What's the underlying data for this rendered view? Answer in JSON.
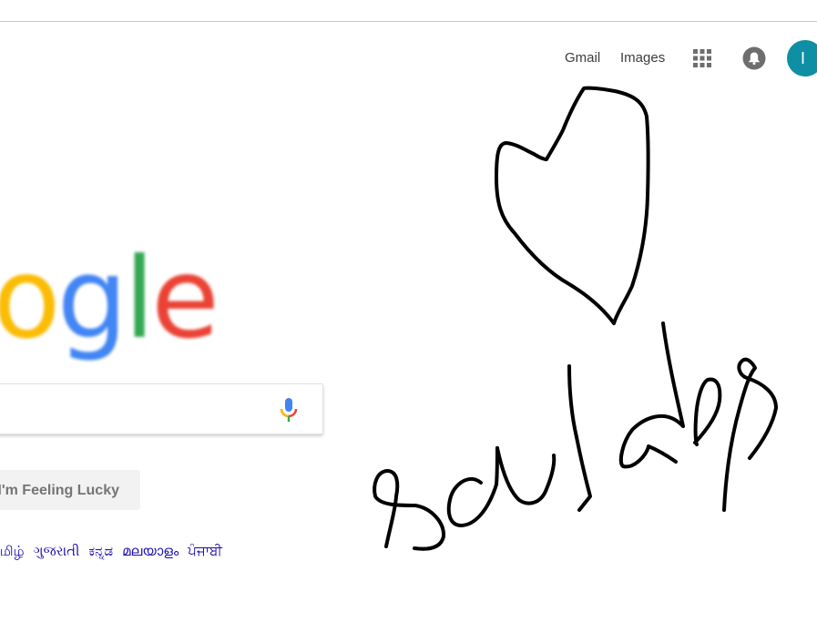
{
  "header": {
    "gmail_label": "Gmail",
    "images_label": "Images",
    "avatar_initial": "I",
    "apps_icon": "apps-grid-icon",
    "bell_icon": "notifications-bell-icon"
  },
  "logo": {
    "visible_letters": [
      "o",
      "g",
      "l",
      "e"
    ],
    "colors": [
      "#FBBC05",
      "#4285F4",
      "#34A853",
      "#EA4335"
    ]
  },
  "search": {
    "value": "",
    "mic_icon": "microphone-icon",
    "mic_colors": [
      "#4285F4",
      "#EA4335",
      "#FBBC05",
      "#34A853"
    ]
  },
  "buttons": {
    "lucky_label": "I'm Feeling Lucky"
  },
  "languages": [
    "தமிழ்",
    "ગુજરાતી",
    "ಕನ್ನಡ",
    "മലയാളം",
    "ਪੰਜਾਬੀ"
  ],
  "colors": {
    "avatar": "#0f8fa3",
    "link": "#1a0dab",
    "ink": "#000000"
  }
}
